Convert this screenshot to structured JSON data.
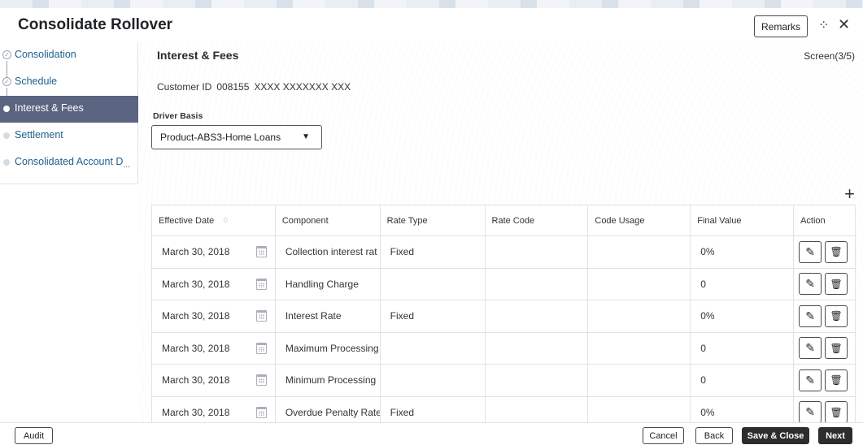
{
  "window": {
    "title": "Consolidate Rollover",
    "remarks_label": "Remarks",
    "minimize_icon": "collapse-icon",
    "close_icon": "close-icon"
  },
  "sidebar": {
    "items": [
      {
        "label": "Consolidation",
        "state": "done"
      },
      {
        "label": "Schedule",
        "state": "done"
      },
      {
        "label": "Interest & Fees",
        "state": "active"
      },
      {
        "label": "Settlement",
        "state": "pending"
      },
      {
        "label": "Consolidated Account D",
        "state": "pending",
        "ellipsis": "..."
      }
    ]
  },
  "main": {
    "section_title": "Interest & Fees",
    "screen_indicator": "Screen(3/5)",
    "customer_label": "Customer ID",
    "customer_id": "008155",
    "customer_name": "XXXX XXXXXXX XXX",
    "driver_basis_label": "Driver Basis",
    "driver_basis_value": "Product-ABS3-Home Loans",
    "add_icon": "plus-icon"
  },
  "table": {
    "headers": {
      "effective_date": "Effective Date",
      "component": "Component",
      "rate_type": "Rate Type",
      "rate_code": "Rate Code",
      "code_usage": "Code Usage",
      "final_value": "Final Value",
      "action": "Action"
    },
    "rows": [
      {
        "date": "March 30, 2018",
        "component": "Collection interest rat",
        "rate_type": "Fixed",
        "rate_code": "",
        "code_usage": "",
        "final_value": "0%"
      },
      {
        "date": "March 30, 2018",
        "component": "Handling Charge",
        "rate_type": "",
        "rate_code": "",
        "code_usage": "",
        "final_value": "0"
      },
      {
        "date": "March 30, 2018",
        "component": "Interest Rate",
        "rate_type": "Fixed",
        "rate_code": "",
        "code_usage": "",
        "final_value": "0%"
      },
      {
        "date": "March 30, 2018",
        "component": "Maximum Processing",
        "rate_type": "",
        "rate_code": "",
        "code_usage": "",
        "final_value": "0"
      },
      {
        "date": "March 30, 2018",
        "component": "Minimum Processing",
        "rate_type": "",
        "rate_code": "",
        "code_usage": "",
        "final_value": "0"
      },
      {
        "date": "March 30, 2018",
        "component": "Overdue Penalty Rate",
        "rate_type": "Fixed",
        "rate_code": "",
        "code_usage": "",
        "final_value": "0%"
      }
    ]
  },
  "footer": {
    "audit": "Audit",
    "cancel": "Cancel",
    "back": "Back",
    "save_close": "Save & Close",
    "next": "Next"
  }
}
